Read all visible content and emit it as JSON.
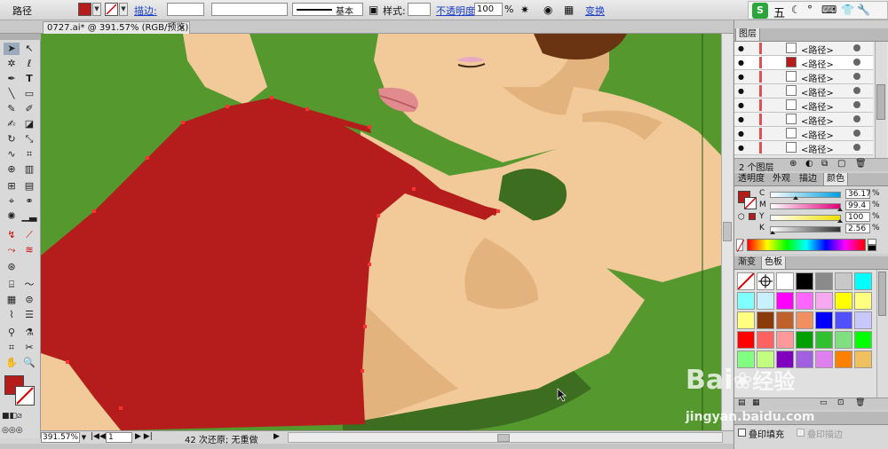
{
  "control_bar": {
    "object_type": "路径",
    "stroke_label": "描边:",
    "brush_label": "基本",
    "style_label": "样式:",
    "opacity_label": "不透明度:",
    "opacity_value": "100",
    "opacity_unit": "%",
    "transform_label": "变换",
    "fill_color": "#b51c1c"
  },
  "tray": {
    "ime_logo": "S",
    "ime_mode": "五",
    "icons": [
      "moon-icon",
      "dot-icon",
      "keyboard-icon",
      "shirt-icon",
      "wrench-icon"
    ]
  },
  "document": {
    "tab_title": "0727.ai* @ 391.57% (RGB/预览)",
    "close_symbol": "×"
  },
  "status_bar": {
    "zoom": "391.57%",
    "artboard": "1",
    "history": "42 次还原; 无重做"
  },
  "layers_panel": {
    "tab": "图层",
    "rows": [
      {
        "label": "<路径>"
      },
      {
        "label": "<路径>",
        "thumb_color": "#b51c1c"
      },
      {
        "label": "<路径>"
      },
      {
        "label": "<路径>"
      },
      {
        "label": "<路径>"
      },
      {
        "label": "<路径>"
      },
      {
        "label": "<路径>"
      },
      {
        "label": "<路径>"
      }
    ],
    "footer": "2 个图层"
  },
  "color_panel": {
    "tabs": [
      "透明度",
      "外观",
      "描边",
      "颜色"
    ],
    "active_tab": "颜色",
    "channels": [
      {
        "key": "C",
        "value": "36.17",
        "level": 0.3617,
        "color": "#00a0e0"
      },
      {
        "key": "M",
        "value": "99.4",
        "level": 0.994,
        "color": "#e0007a"
      },
      {
        "key": "Y",
        "value": "100",
        "level": 1.0,
        "color": "#f0e000"
      },
      {
        "key": "K",
        "value": "2.56",
        "level": 0.0256,
        "color": "#333333"
      }
    ],
    "pct": "%"
  },
  "swatches_panel": {
    "tabs": [
      "渐变",
      "色板"
    ],
    "active_tab": "色板",
    "colors": [
      "none",
      "registration",
      "#ffffff",
      "#000000",
      "#8a8a8a",
      "#c8c8c8",
      "#00ffff",
      "#80ffff",
      "#c8f0ff",
      "#ff00ff",
      "#ff66ff",
      "#f8a8f0",
      "#ffff00",
      "#ffff80",
      "#ffff80",
      "#8b3a0a",
      "#c0602a",
      "#f09060",
      "#0000ff",
      "#5050ff",
      "#c8c8ff",
      "#ff0000",
      "#ff6060",
      "#ff9999",
      "#00a000",
      "#30c030",
      "#80e080",
      "#00ff00",
      "#80ff80",
      "#c0ff80",
      "#8000c0",
      "#a060e0",
      "#e080f0",
      "#ff8000",
      "#f0c060"
    ]
  },
  "appearance_panel": {
    "overprint_fill": "叠印填充",
    "overprint_stroke": "叠印描边"
  },
  "watermark": {
    "brand": "Bai",
    "brand2": "经验",
    "url": "jingyan.baidu.com"
  }
}
